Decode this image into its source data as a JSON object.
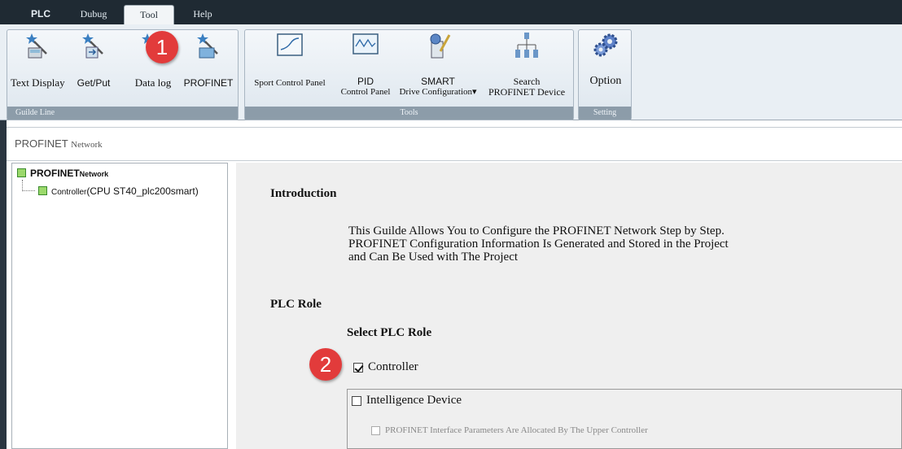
{
  "menu": {
    "tabs": [
      "PLC",
      "Dubug",
      "Tool",
      "Help"
    ],
    "active": "Tool"
  },
  "ribbon": {
    "guide_group": {
      "label": "Guilde Line",
      "buttons": [
        {
          "label": "Text Display",
          "icon": "text-display-wizard-icon"
        },
        {
          "label": "Get/Put",
          "icon": "get-put-wizard-icon"
        },
        {
          "label": "Data log",
          "icon": "data-log-wizard-icon"
        },
        {
          "label": "PROFINET",
          "icon": "profinet-wizard-icon"
        }
      ]
    },
    "tools_group": {
      "label": "Tools",
      "buttons": [
        {
          "label": "Sport Control Panel",
          "icon": "control-panel-icon"
        },
        {
          "label": "PID",
          "label2": "Control Panel",
          "icon": "pid-panel-icon"
        },
        {
          "label": "SMART",
          "label2": "Drive Configuration▾",
          "icon": "drive-config-icon"
        },
        {
          "label": "Search",
          "label2": "PROFINET Device",
          "icon": "network-search-icon"
        }
      ]
    },
    "setting_group": {
      "label": "Setting",
      "buttons": [
        {
          "label": "Option",
          "icon": "gears-icon"
        }
      ]
    }
  },
  "page": {
    "title_main": "PROFINET",
    "title_small": "Network"
  },
  "tree": {
    "root_main": "PROFINET",
    "root_small": "Network",
    "child_small": "Controller",
    "child_main": "(CPU ST40_plc200smart)"
  },
  "content": {
    "intro_heading": "Introduction",
    "intro_lines": [
      "This Guilde Allows You to Configure the PROFINET Network Step by Step.",
      "PROFINET Configuration Information Is Generated and Stored in the Project",
      "and Can Be Used with The Project"
    ],
    "plc_role_heading": "PLC Role",
    "select_role_heading": "Select PLC Role",
    "controller_label": "Controller",
    "controller_checked": true,
    "intelligence_label": "Intelligence Device",
    "intelligence_checked": false,
    "profinet_params_label": "PROFINET Interface Parameters Are Allocated By The Upper Controller",
    "profinet_params_checked": false
  },
  "callouts": [
    "1",
    "2"
  ],
  "colors": {
    "menubar": "#1f2a33",
    "ribbon_footer": "#8c9ca9",
    "badge": "#e23b3b",
    "tree_node": "#9bd96b"
  }
}
